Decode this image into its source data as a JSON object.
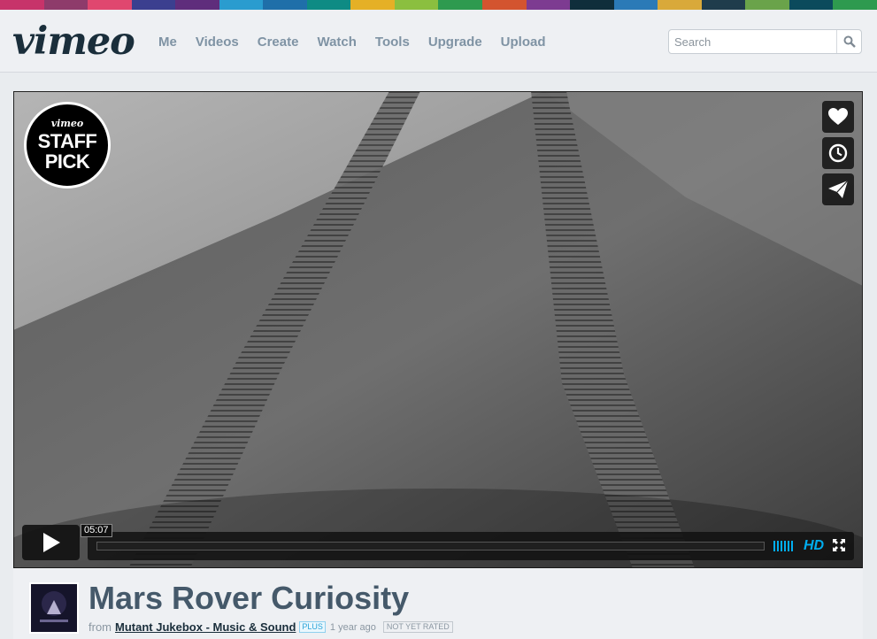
{
  "header": {
    "logo": "vimeo",
    "nav": [
      "Me",
      "Videos",
      "Create",
      "Watch",
      "Tools",
      "Upgrade",
      "Upload"
    ],
    "search": {
      "placeholder": "Search",
      "value": "",
      "icon": "magnifier-icon"
    }
  },
  "stripe_colors": [
    "#c7336a",
    "#8e3b6b",
    "#e0476f",
    "#3b3f8f",
    "#5f2d7c",
    "#2a9ccf",
    "#1f6fa9",
    "#0e8b84",
    "#e5b026",
    "#8bbf3f",
    "#2e9a4f",
    "#d3542f",
    "#7d3b91",
    "#0f2e3b",
    "#2b7ab7",
    "#d9a93a",
    "#1f3c4c",
    "#6aa34a",
    "#0b4a5c",
    "#2e9a4f"
  ],
  "player": {
    "badge": {
      "top": "vimeo",
      "line1": "STAFF",
      "line2": "PICK"
    },
    "side_buttons": [
      "heart-icon",
      "clock-icon",
      "paper-plane-icon"
    ],
    "time": "05:07",
    "progress_fraction": 0.0,
    "hd_label": "HD",
    "accent": "#00adef"
  },
  "video": {
    "title": "Mars Rover Curiosity",
    "from_label": "from",
    "author": "Mutant Jukebox - Music & Sound",
    "plus_badge": "PLUS",
    "uploaded": "1 year ago",
    "rating": "NOT YET RATED"
  }
}
